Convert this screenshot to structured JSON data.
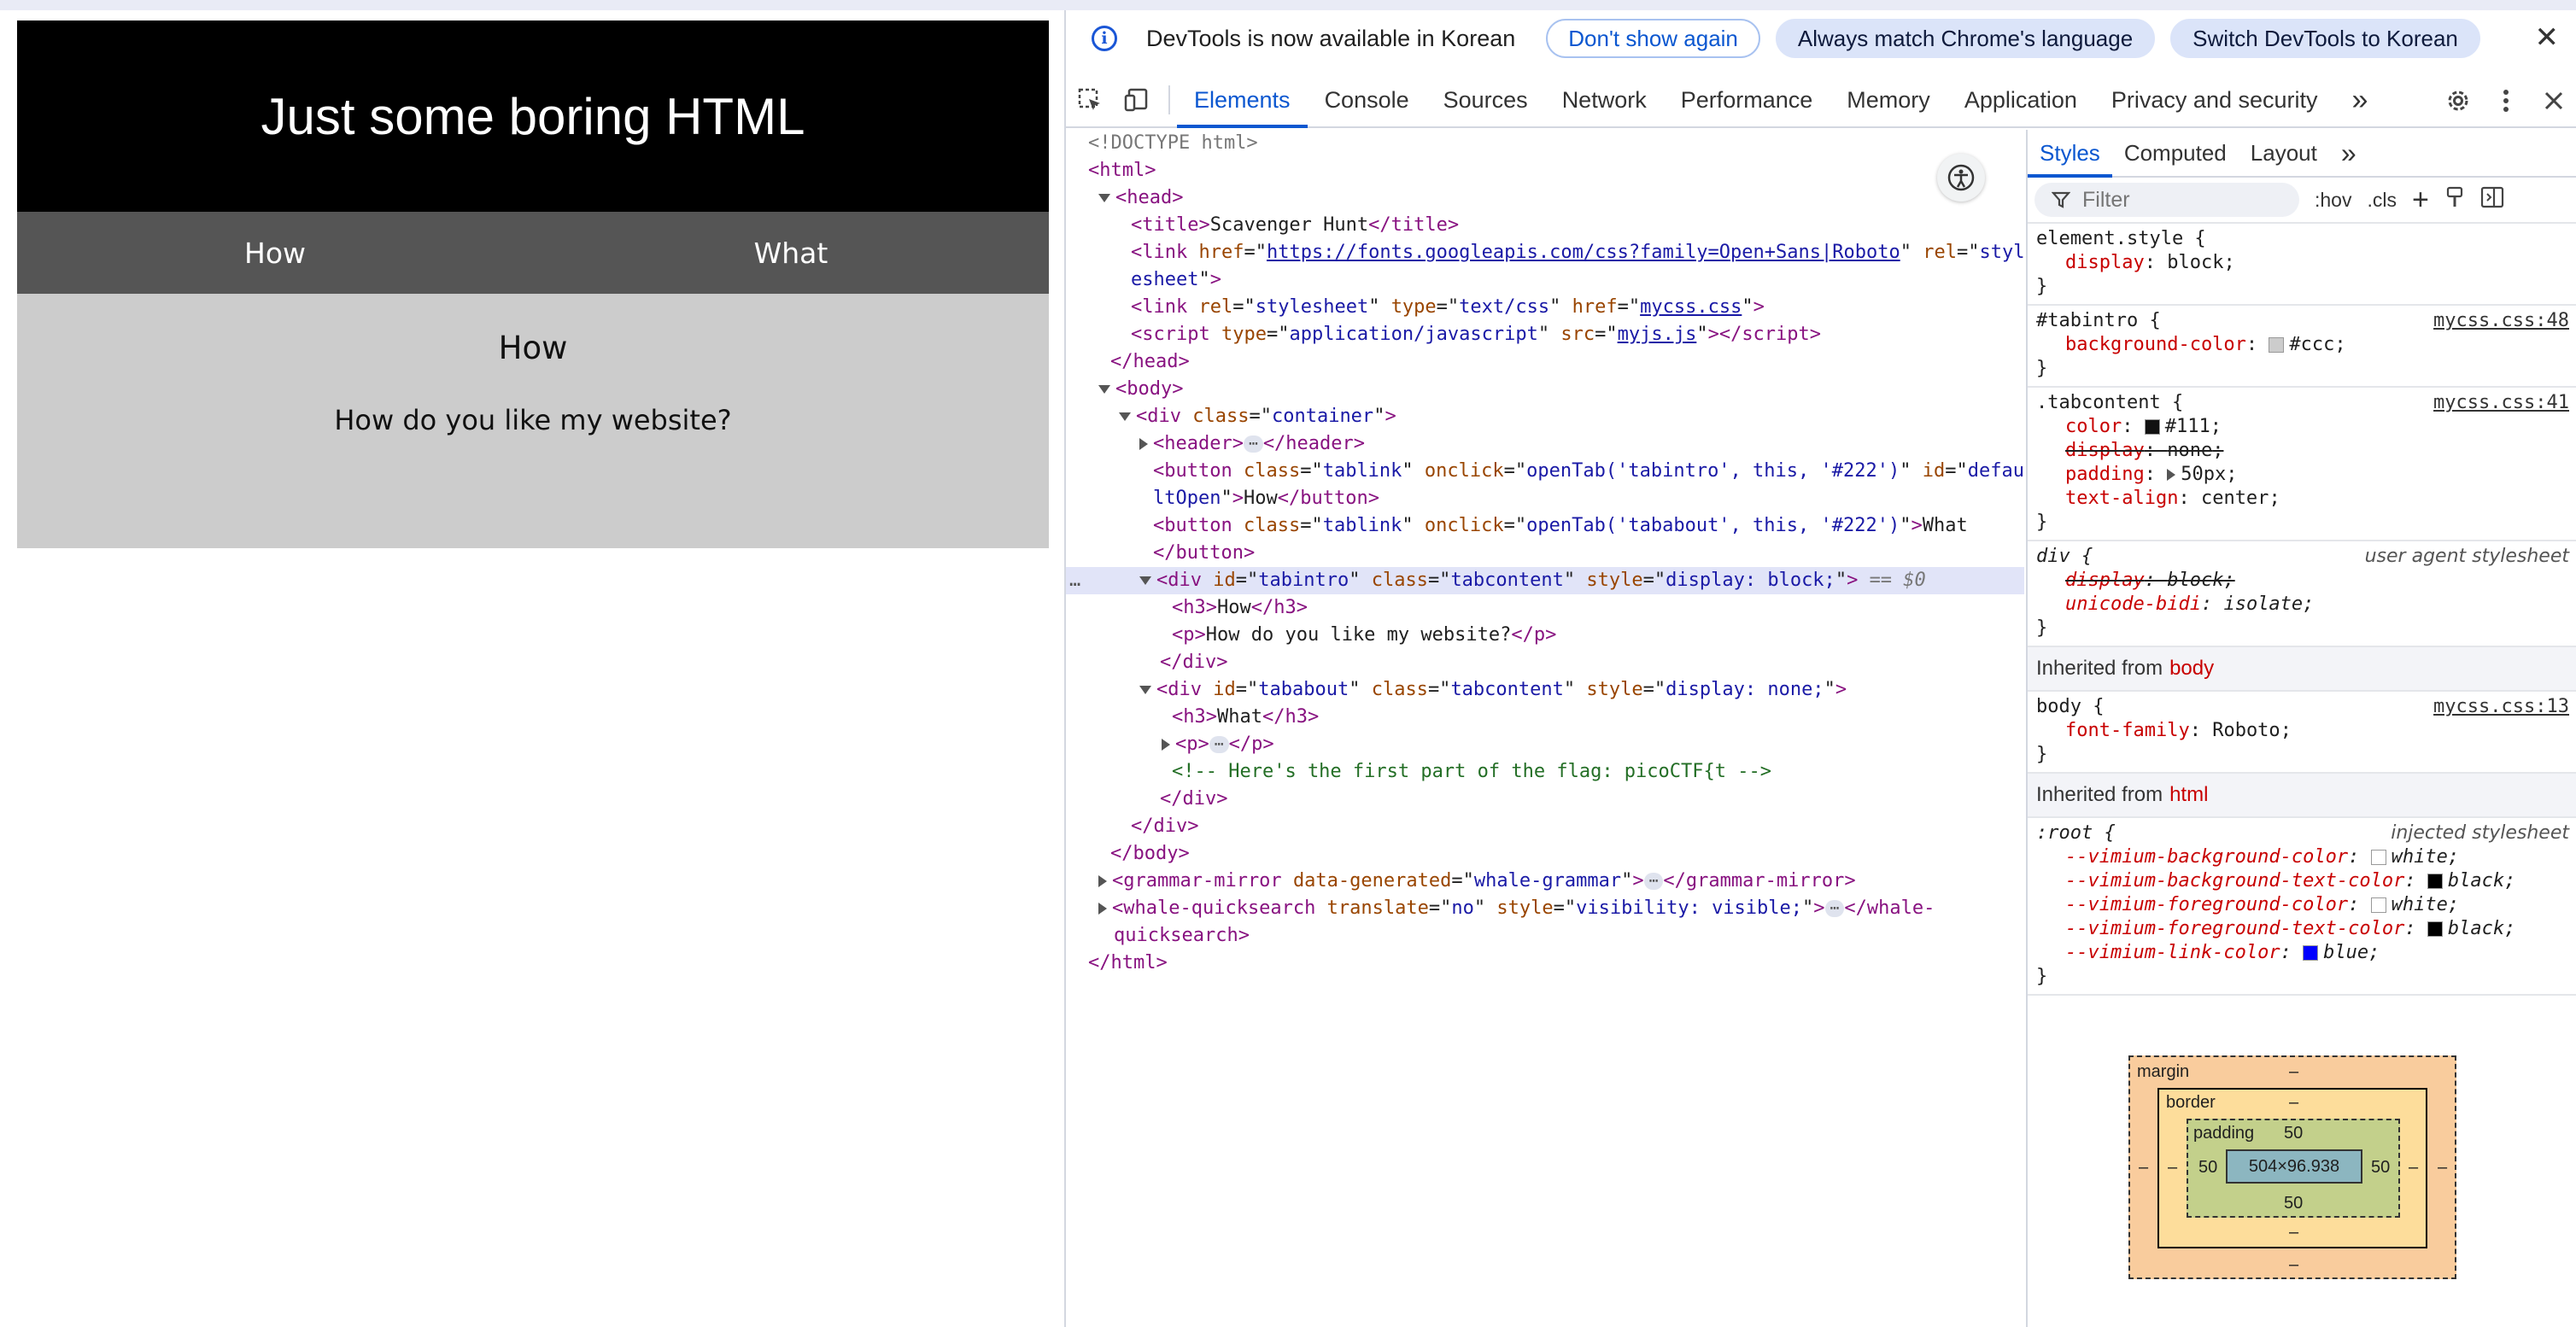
{
  "site": {
    "title": "Just some boring HTML",
    "tabs": [
      "How",
      "What"
    ],
    "content_heading": "How",
    "content_text": "How do you like my website?"
  },
  "infobar": {
    "message": "DevTools is now available in Korean",
    "btn_dont_show": "Don't show again",
    "btn_match": "Always match Chrome's language",
    "btn_switch": "Switch DevTools to Korean",
    "close": "✕"
  },
  "toolbar": {
    "tabs": [
      "Elements",
      "Console",
      "Sources",
      "Network",
      "Performance",
      "Memory",
      "Application",
      "Privacy and security"
    ],
    "more": "»"
  },
  "elements": {
    "selected_marker": "== $0",
    "dots": "…"
  },
  "styles": {
    "tabs": [
      "Styles",
      "Computed",
      "Layout"
    ],
    "more": "»",
    "filter_placeholder": "Filter",
    "hov": ":hov",
    "cls": ".cls",
    "inherited_label": "Inherited from",
    "inherited_body": "body",
    "inherited_html": "html"
  },
  "box_model": {
    "margin_label": "margin",
    "border_label": "border",
    "padding_label": "padding",
    "margin": "–",
    "border": "–",
    "padding_top": "50",
    "padding_right": "50",
    "padding_bottom": "50",
    "padding_left": "50",
    "content_size": "504×96.938"
  },
  "colors": {
    "accent": "#0b57d0",
    "tag": "#881280",
    "attr_name": "#994500",
    "attr_value": "#1a1aa6",
    "comment": "#236e25"
  }
}
